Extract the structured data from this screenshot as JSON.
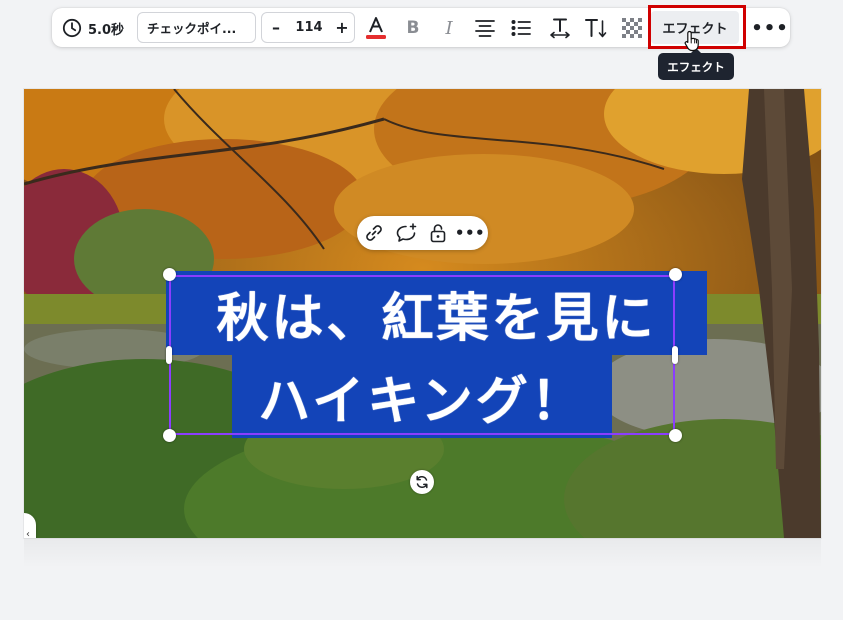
{
  "toolbar": {
    "duration": "5.0秒",
    "font_name": "チェックポイ...",
    "font_size_minus": "–",
    "font_size": "114",
    "font_size_plus": "+",
    "text_color_icon": "text-color-icon",
    "text_color": "#e52e2e",
    "bold_label": "B",
    "italic_label": "I",
    "effect_label": "エフェクト",
    "more_label": "•••"
  },
  "tooltip": {
    "text": "エフェクト"
  },
  "context_bar": {
    "more_label": "•••"
  },
  "canvas": {
    "text_line1": "秋は、紅葉を見に",
    "text_line2": "ハイキング！",
    "text_background_color": "#1344b8",
    "selection_color": "#8b3dff"
  },
  "highlight": {
    "color": "#d00000"
  },
  "left_handle": {
    "label": "‹"
  }
}
